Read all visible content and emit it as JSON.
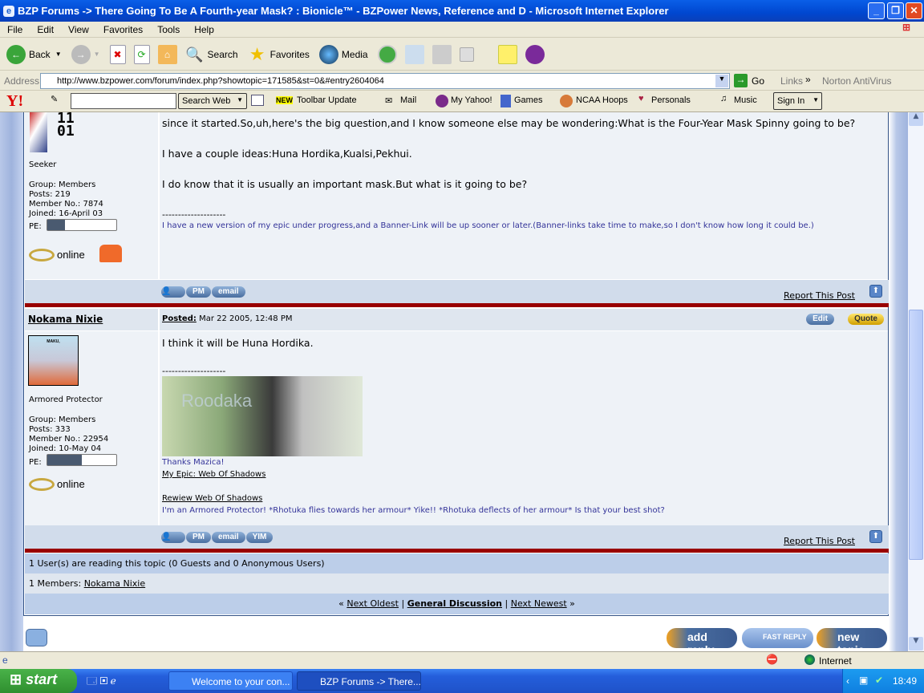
{
  "window": {
    "title": "BZP Forums -> There Going To Be A Fourth-year Mask? : Bionicle™ - BZPower News, Reference and D - Microsoft Internet Explorer"
  },
  "menu": [
    "File",
    "Edit",
    "View",
    "Favorites",
    "Tools",
    "Help"
  ],
  "toolbar": {
    "back": "Back",
    "search": "Search",
    "favorites": "Favorites",
    "media": "Media"
  },
  "address": {
    "label": "Address",
    "url": "http://www.bzpower.com/forum/index.php?showtopic=171585&st=0&#entry2604064",
    "go": "Go",
    "links": "Links",
    "norton": "Norton AntiVirus"
  },
  "yahoo": {
    "search_value": "",
    "search_web": "Search Web",
    "toolbar_update": "Toolbar Update",
    "new_badge": "NEW",
    "mail": "Mail",
    "my_yahoo": "My Yahoo!",
    "games": "Games",
    "ncaa": "NCAA Hoops",
    "personals": "Personals",
    "music": "Music",
    "sign_in": "Sign In"
  },
  "post1": {
    "avatar_text": "11\n01",
    "rank": "Seeker",
    "group": "Group: Members",
    "posts": "Posts: 219",
    "member_no": "Member No.: 7874",
    "joined": "Joined: 16-April 03",
    "pe": "PE:",
    "pe_level": 0.25,
    "status": "online",
    "body": [
      "since it started.So,uh,here's the big question,and I know someone else may be wondering:What is the Four-Year Mask Spinny going to be?",
      "I have a couple ideas:Huna Hordika,Kualsi,Pekhui.",
      "I do know that it is usually an important mask.But what is it going to be?"
    ],
    "sig_sep": "--------------------",
    "sig": "I have a new version of my epic under progress,and a Banner-Link will be up sooner or later.(Banner-links take time to make,so I don't know how long it could be.)",
    "buttons": [
      "PM",
      "email"
    ],
    "report": "Report This Post"
  },
  "post2": {
    "author": "Nokama Nixie",
    "posted_label": "Posted:",
    "posted": "Mar 22 2005, 12:48 PM",
    "edit": "Edit",
    "quote": "Quote",
    "avatar_caption": "MAKU,",
    "rank": "Armored Protector",
    "group": "Group: Members",
    "posts": "Posts: 333",
    "member_no": "Member No.: 22954",
    "joined": "Joined: 10-May 04",
    "pe": "PE:",
    "pe_level": 0.5,
    "status": "online",
    "body": "I think it will be Huna Hordika.",
    "sig_sep": "--------------------",
    "banner_text": "Roodaka",
    "thanks": "Thanks Mazica!",
    "epic_link": "My Epic: Web Of Shadows",
    "review_link": "Rewiew Web Of Shadows",
    "quote_line": "I'm an Armored Protector! *Rhotuka flies towards her armour* Yike!! *Rhotuka deflects of her armour* Is that your best shot?",
    "buttons": [
      "PM",
      "email",
      "YIM"
    ],
    "report": "Report This Post"
  },
  "readers": {
    "summary": "1 User(s) are reading this topic (0 Guests and 0 Anonymous Users)",
    "members_label": "1 Members:",
    "member": "Nokama Nixie"
  },
  "nav": {
    "prev_arrow": "«",
    "next_oldest": "Next Oldest",
    "sep": "|",
    "forum": "General Discussion",
    "next_newest": "Next Newest",
    "next_arrow": "»"
  },
  "actions": {
    "add_reply": "add reply",
    "fast_reply": "FAST REPLY",
    "new_topic": "new topic"
  },
  "status": {
    "zone": "Internet"
  },
  "taskbar": {
    "start": "start",
    "tasks": [
      "Welcome to your con...",
      "BZP Forums -> There..."
    ],
    "clock": "18:49"
  }
}
